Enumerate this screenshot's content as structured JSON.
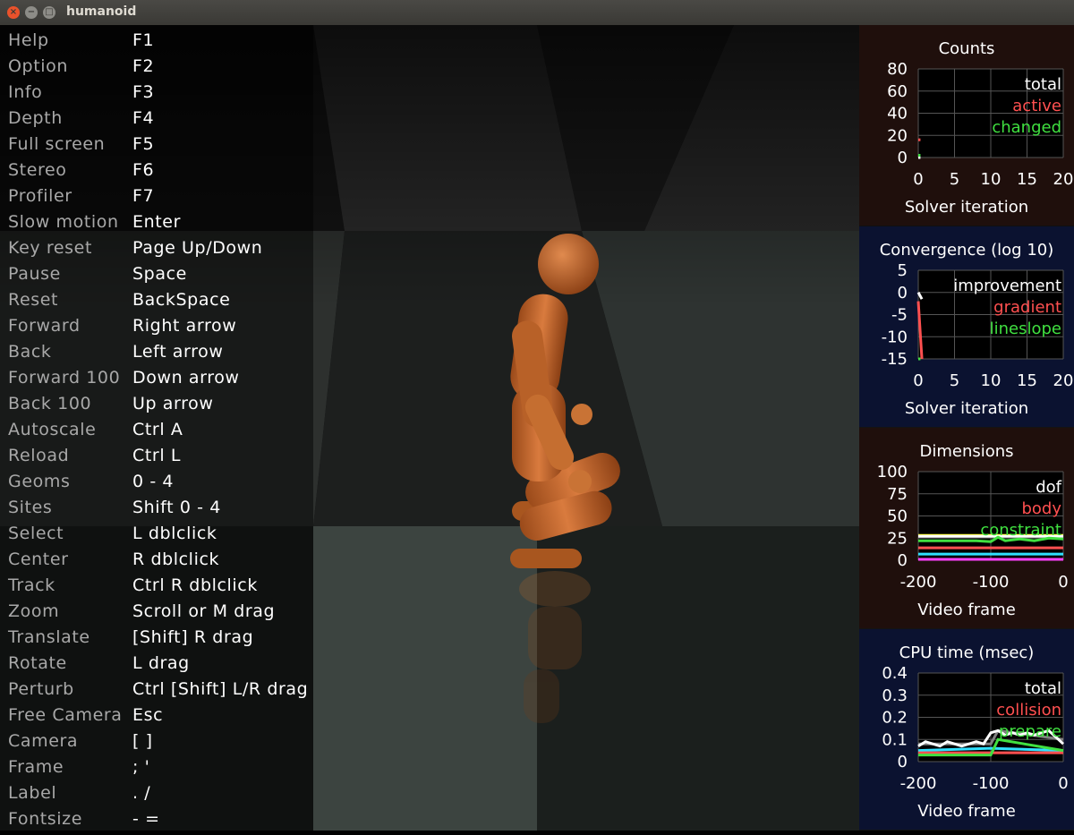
{
  "window": {
    "title": "humanoid",
    "close_glyph": "×",
    "min_glyph": "−",
    "max_glyph": "□"
  },
  "help": [
    {
      "label": "Help",
      "key": "F1"
    },
    {
      "label": "Option",
      "key": "F2"
    },
    {
      "label": "Info",
      "key": "F3"
    },
    {
      "label": "Depth",
      "key": "F4"
    },
    {
      "label": "Full screen",
      "key": "F5"
    },
    {
      "label": "Stereo",
      "key": "F6"
    },
    {
      "label": "Profiler",
      "key": "F7"
    },
    {
      "label": "Slow motion",
      "key": "Enter"
    },
    {
      "label": "Key reset",
      "key": "Page Up/Down"
    },
    {
      "label": "Pause",
      "key": "Space"
    },
    {
      "label": "Reset",
      "key": "BackSpace"
    },
    {
      "label": "Forward",
      "key": "Right arrow"
    },
    {
      "label": "Back",
      "key": "Left arrow"
    },
    {
      "label": "Forward 100",
      "key": "Down arrow"
    },
    {
      "label": "Back 100",
      "key": "Up arrow"
    },
    {
      "label": "Autoscale",
      "key": "Ctrl A"
    },
    {
      "label": "Reload",
      "key": "Ctrl L"
    },
    {
      "label": "Geoms",
      "key": "0 - 4"
    },
    {
      "label": "Sites",
      "key": "Shift 0 - 4"
    },
    {
      "label": "Select",
      "key": "L dblclick"
    },
    {
      "label": "Center",
      "key": "R dblclick"
    },
    {
      "label": "Track",
      "key": "Ctrl R dblclick"
    },
    {
      "label": "Zoom",
      "key": "Scroll or M drag"
    },
    {
      "label": "Translate",
      "key": "[Shift] R drag"
    },
    {
      "label": "Rotate",
      "key": "L drag"
    },
    {
      "label": "Perturb",
      "key": "Ctrl [Shift] L/R drag"
    },
    {
      "label": "Free Camera",
      "key": "Esc"
    },
    {
      "label": "Camera",
      "key": "[ ]"
    },
    {
      "label": "Frame",
      "key": "; '"
    },
    {
      "label": "Label",
      "key": ". /"
    },
    {
      "label": "Fontsize",
      "key": "- ="
    }
  ],
  "chart_data": [
    {
      "type": "line",
      "title": "Counts",
      "xlabel": "Solver iteration",
      "ylabel": "",
      "xlim": [
        0,
        20
      ],
      "ylim": [
        0,
        80
      ],
      "xticks": [
        "0",
        "5",
        "10",
        "15",
        "20"
      ],
      "yticks": [
        "80",
        "60",
        "40",
        "20",
        "0"
      ],
      "panel_bg": "#1f0f0c",
      "legend_position": "top-right",
      "series": [
        {
          "name": "total",
          "color": "#ffffff",
          "x": [
            0,
            0.3
          ],
          "y": [
            0,
            0
          ]
        },
        {
          "name": "active",
          "color": "#ff5050",
          "x": [
            0,
            0.3
          ],
          "y": [
            16,
            16
          ]
        },
        {
          "name": "changed",
          "color": "#40e040",
          "x": [
            0,
            0.3
          ],
          "y": [
            2,
            2
          ]
        }
      ]
    },
    {
      "type": "line",
      "title": "Convergence (log 10)",
      "xlabel": "Solver iteration",
      "ylabel": "",
      "xlim": [
        0,
        20
      ],
      "ylim": [
        -15,
        5
      ],
      "xticks": [
        "0",
        "5",
        "10",
        "15",
        "20"
      ],
      "yticks": [
        "5",
        "0",
        "-5",
        "-10",
        "-15"
      ],
      "panel_bg": "#0b1230",
      "legend_position": "top-right",
      "series": [
        {
          "name": "improvement",
          "color": "#ffffff",
          "x": [
            0,
            0.5
          ],
          "y": [
            0,
            -1.5
          ]
        },
        {
          "name": "gradient",
          "color": "#ff5050",
          "x": [
            0,
            0.5
          ],
          "y": [
            -2,
            -15
          ]
        },
        {
          "name": "lineslope",
          "color": "#40e040",
          "x": [
            0,
            0.3
          ],
          "y": [
            -15,
            -15
          ]
        }
      ]
    },
    {
      "type": "line",
      "title": "Dimensions",
      "xlabel": "Video frame",
      "ylabel": "",
      "xlim": [
        -200,
        0
      ],
      "ylim": [
        0,
        100
      ],
      "xticks": [
        "-200",
        "-100",
        "0"
      ],
      "yticks": [
        "100",
        "75",
        "50",
        "25",
        "0"
      ],
      "panel_bg": "#1f0f0c",
      "legend_position": "top-right",
      "series": [
        {
          "name": "dof",
          "color": "#ffffff",
          "x": [
            -200,
            0
          ],
          "y": [
            27,
            27
          ]
        },
        {
          "name": "body",
          "color": "#ff5050",
          "x": [
            -200,
            0
          ],
          "y": [
            14,
            14
          ]
        },
        {
          "name": "constraint",
          "color": "#40e040",
          "x": [
            -200,
            -120,
            -100,
            -90,
            -80,
            -60,
            -40,
            -20,
            0
          ],
          "y": [
            22,
            22,
            21,
            26,
            22,
            24,
            22,
            25,
            24
          ]
        }
      ],
      "extra_lines": [
        {
          "color": "#ffff30",
          "x": [
            -200,
            0
          ],
          "y": [
            28,
            28
          ]
        },
        {
          "color": "#30e0ff",
          "x": [
            -200,
            0
          ],
          "y": [
            7,
            7
          ]
        },
        {
          "color": "#ff40ff",
          "x": [
            -200,
            0
          ],
          "y": [
            1,
            1
          ]
        }
      ]
    },
    {
      "type": "line",
      "title": "CPU time (msec)",
      "xlabel": "Video frame",
      "ylabel": "",
      "xlim": [
        -200,
        0
      ],
      "ylim": [
        0,
        0.4
      ],
      "xticks": [
        "-200",
        "-100",
        "0"
      ],
      "yticks": [
        "0.4",
        "0.3",
        "0.2",
        "0.1",
        "0"
      ],
      "panel_bg": "#0b1230",
      "legend_position": "top-right",
      "series": [
        {
          "name": "total",
          "color": "#ffffff",
          "x": [
            -200,
            -190,
            -180,
            -170,
            -160,
            -150,
            -140,
            -130,
            -120,
            -110,
            -100,
            -90,
            -80,
            -70,
            -60,
            -50,
            -40,
            -30,
            -20,
            -10,
            0
          ],
          "y": [
            0.07,
            0.09,
            0.08,
            0.07,
            0.09,
            0.08,
            0.07,
            0.08,
            0.09,
            0.08,
            0.13,
            0.14,
            0.12,
            0.13,
            0.12,
            0.13,
            0.12,
            0.13,
            0.14,
            0.11,
            0.08
          ]
        },
        {
          "name": "collision",
          "color": "#ff5050",
          "x": [
            -200,
            0
          ],
          "y": [
            0.04,
            0.04
          ]
        },
        {
          "name": "prepare",
          "color": "#40e040",
          "x": [
            -200,
            -100,
            -90,
            0
          ],
          "y": [
            0.03,
            0.03,
            0.1,
            0.05
          ]
        }
      ],
      "extra_lines": [
        {
          "color": "#30e0ff",
          "x": [
            -200,
            -100,
            0
          ],
          "y": [
            0.05,
            0.06,
            0.05
          ]
        },
        {
          "color": "#808080",
          "x": [
            -200,
            -100,
            -90,
            0
          ],
          "y": [
            0.08,
            0.08,
            0.14,
            0.1
          ]
        }
      ]
    }
  ]
}
